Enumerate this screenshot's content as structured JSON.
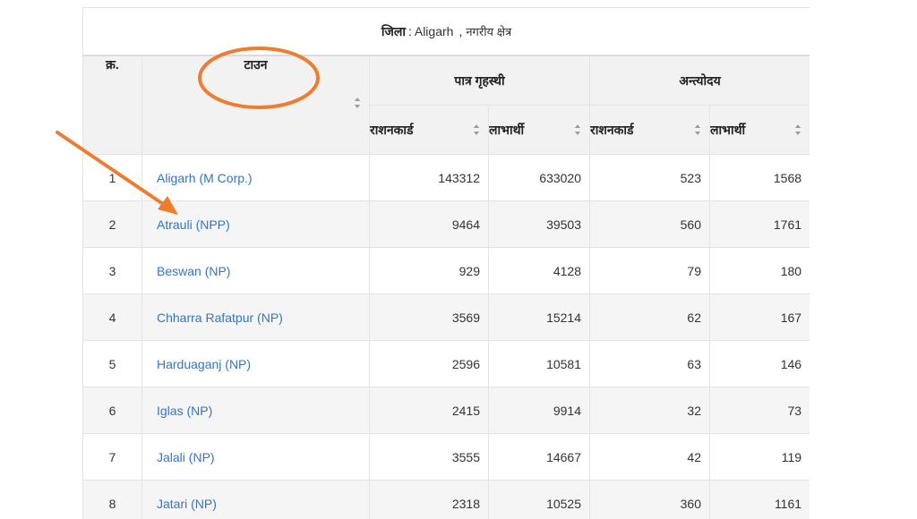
{
  "caption": {
    "district_label": "जिला",
    "separator": ":",
    "district_value": "Aligarh",
    "comma": ",",
    "area_type": "नगरीय क्षेत्र"
  },
  "headers": {
    "serial": "क्र.",
    "town": "टाउन",
    "group_1": "पात्र गृहस्थी",
    "group_2": "अन्त्योदय",
    "ration_cards": "राशनकार्ड",
    "beneficiaries": "लाभार्थी"
  },
  "rows": [
    {
      "sn": "1",
      "town": "Aligarh (M Corp.)",
      "ph_cards": "143312",
      "ph_beneficiaries": "633020",
      "aay_cards": "523",
      "aay_beneficiaries": "1568"
    },
    {
      "sn": "2",
      "town": "Atrauli (NPP)",
      "ph_cards": "9464",
      "ph_beneficiaries": "39503",
      "aay_cards": "560",
      "aay_beneficiaries": "1761"
    },
    {
      "sn": "3",
      "town": "Beswan (NP)",
      "ph_cards": "929",
      "ph_beneficiaries": "4128",
      "aay_cards": "79",
      "aay_beneficiaries": "180"
    },
    {
      "sn": "4",
      "town": "Chharra Rafatpur (NP)",
      "ph_cards": "3569",
      "ph_beneficiaries": "15214",
      "aay_cards": "62",
      "aay_beneficiaries": "167"
    },
    {
      "sn": "5",
      "town": "Harduaganj (NP)",
      "ph_cards": "2596",
      "ph_beneficiaries": "10581",
      "aay_cards": "63",
      "aay_beneficiaries": "146"
    },
    {
      "sn": "6",
      "town": "Iglas (NP)",
      "ph_cards": "2415",
      "ph_beneficiaries": "9914",
      "aay_cards": "32",
      "aay_beneficiaries": "73"
    },
    {
      "sn": "7",
      "town": "Jalali (NP)",
      "ph_cards": "3555",
      "ph_beneficiaries": "14667",
      "aay_cards": "42",
      "aay_beneficiaries": "119"
    },
    {
      "sn": "8",
      "town": "Jatari (NP)",
      "ph_cards": "2318",
      "ph_beneficiaries": "10525",
      "aay_cards": "360",
      "aay_beneficiaries": "1161"
    }
  ],
  "colors": {
    "link": "#2f76c6",
    "annotation": "#ed7d31",
    "header_bg": "#f2f2f2",
    "stripe_bg": "#f5f5f5"
  },
  "icons": {
    "sort": "sort-icon",
    "annotation_ellipse": "ellipse-highlight-icon",
    "annotation_arrow": "arrow-icon"
  }
}
